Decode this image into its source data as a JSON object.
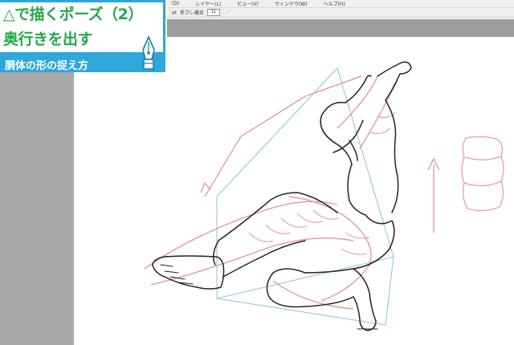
{
  "title_card": {
    "line1": "△で描くポーズ（2）",
    "line2": "奥行きを出す",
    "subtitle": "胴体の形の捉え方",
    "pen_icon": "pen-nib-icon"
  },
  "menubar": {
    "items": [
      "(D)",
      "レイヤー(L)",
      "ビュー(V)",
      "ウィンドウ(W)",
      "ヘルプ(H)"
    ]
  },
  "toolbar": {
    "label": "手ブレ補正",
    "value": "11",
    "icon": "brush-settings-icon"
  },
  "colors": {
    "brand_green": "#23a84a",
    "brand_blue": "#2fa8d9",
    "sketch_red": "#e08a8a",
    "sketch_guide_blue": "#8fc9d9"
  }
}
